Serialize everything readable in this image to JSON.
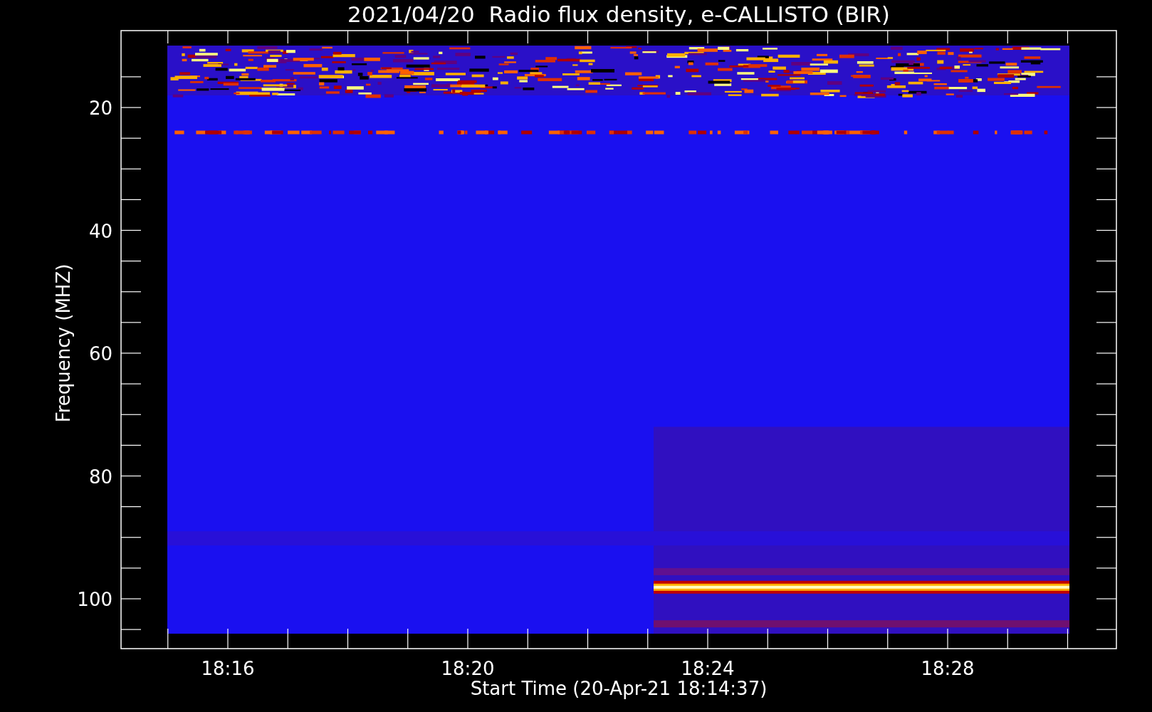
{
  "title": "2021/04/20  Radio flux density, e-CALLISTO (BIR)",
  "y_axis": {
    "label": "Frequency (MHZ)",
    "ticks": [
      "20",
      "40",
      "60",
      "80",
      "100"
    ]
  },
  "x_axis": {
    "label": "Start Time (20-Apr-21 18:14:37)",
    "ticks": [
      "18:16",
      "18:20",
      "18:24",
      "18:28"
    ]
  }
}
